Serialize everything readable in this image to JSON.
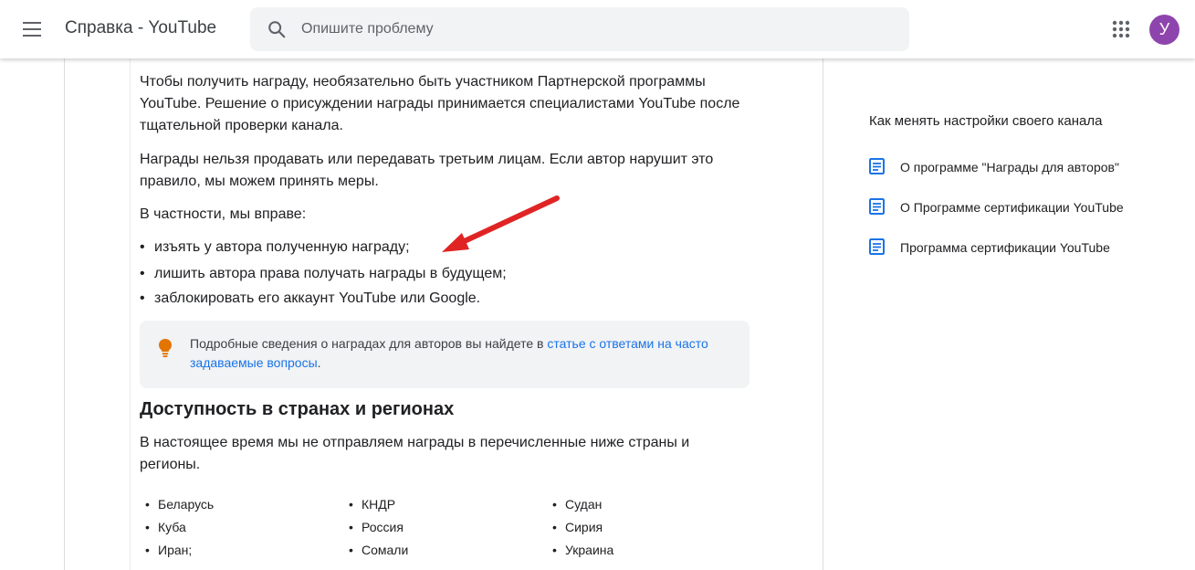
{
  "header": {
    "title": "Справка - YouTube",
    "search_placeholder": "Опишите проблему",
    "avatar_letter": "У"
  },
  "article": {
    "para1": "Чтобы получить награду, необязательно быть участником Партнерской программы YouTube. Решение о присуждении награды принимается специалистами YouTube после тщательной проверки канала.",
    "para2": "Награды нельзя продавать или передавать третьим лицам. Если автор нарушит это правило, мы можем принять меры.",
    "para3": "В частности, мы вправе:",
    "bullets": [
      "изъять у автора полученную награду;",
      "лишить автора права получать награды в будущем;",
      "заблокировать его аккаунт YouTube или Google."
    ],
    "note": {
      "text_before": "Подробные сведения о наградах для авторов вы найдете в ",
      "link": "статье с ответами на часто задаваемые вопросы",
      "text_after": "."
    },
    "section_heading": "Доступность в странах и регионах",
    "section_para": "В настоящее время мы не отправляем награды в перечисленные ниже страны и регионы.",
    "countries": [
      [
        "Беларусь",
        "Куба",
        "Иран;"
      ],
      [
        "КНДР",
        "Россия",
        "Сомали"
      ],
      [
        "Судан",
        "Сирия",
        "Украина"
      ]
    ]
  },
  "sidebar": {
    "title": "Как менять настройки своего канала",
    "items": [
      "О программе \"Награды для авторов\"",
      "О Программе сертификации YouTube",
      "Программа сертификации YouTube"
    ]
  },
  "colors": {
    "link": "#1a73e8",
    "arrow": "#e02424",
    "avatar": "#8e44ad",
    "doc_icon": "#1a73e8",
    "bulb": "#e37400"
  }
}
